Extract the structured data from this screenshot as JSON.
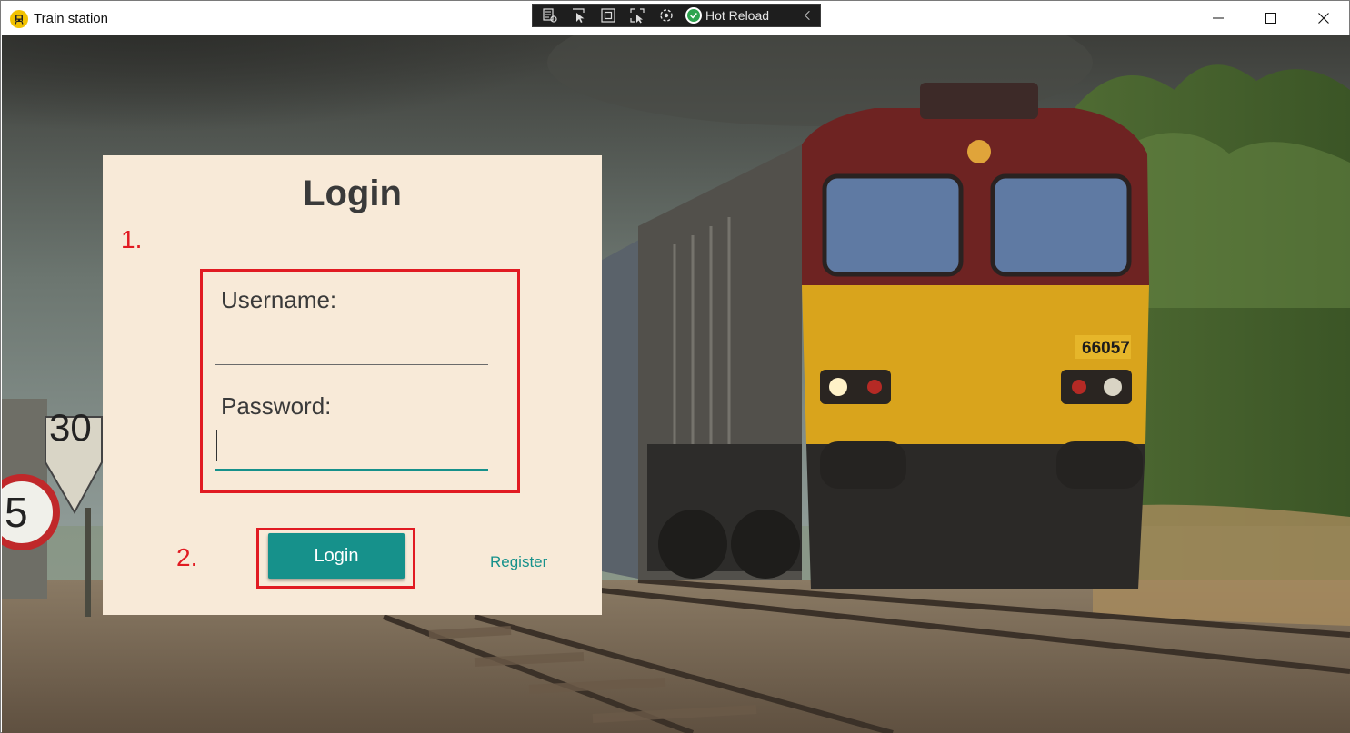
{
  "window": {
    "title": "Train station",
    "icon": "train-icon"
  },
  "devbar": {
    "hot_reload_label": "Hot Reload",
    "tools": [
      "select-element-icon",
      "pointer-select-icon",
      "layout-adorner-icon",
      "track-focus-icon",
      "binding-failures-icon"
    ]
  },
  "login_card": {
    "title": "Login",
    "username_label": "Username:",
    "username_value": "",
    "password_label": "Password:",
    "password_value": "",
    "login_button": "Login",
    "register_link": "Register"
  },
  "annotations": {
    "step1": "1.",
    "step2": "2."
  },
  "colors": {
    "accent": "#16918b",
    "card_bg": "#f8ead8",
    "annotation": "#e11b22"
  }
}
